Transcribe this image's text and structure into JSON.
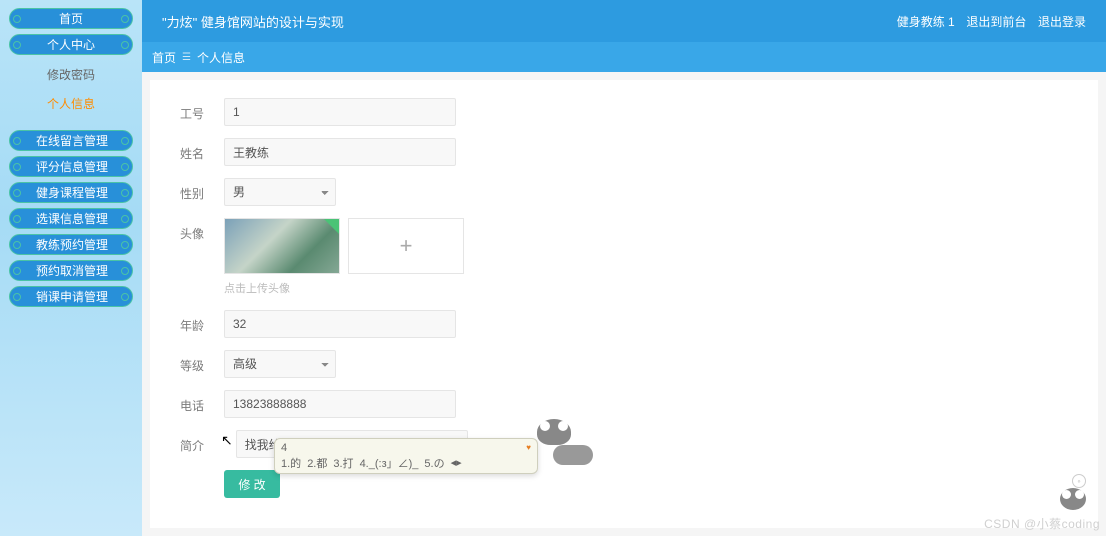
{
  "app_title": "\"力炫\" 健身馆网站的设计与实现",
  "user_role": "健身教练 1",
  "top_actions": {
    "exit_back": "退出到前台",
    "logout": "退出登录"
  },
  "sidebar": {
    "home": "首页",
    "personal_center": "个人中心",
    "sub": {
      "change_pwd": "修改密码",
      "personal_info": "个人信息"
    },
    "items": [
      "在线留言管理",
      "评分信息管理",
      "健身课程管理",
      "选课信息管理",
      "教练预约管理",
      "预约取消管理",
      "销课申请管理"
    ]
  },
  "breadcrumb": {
    "root": "首页",
    "current": "个人信息"
  },
  "form": {
    "id_label": "工号",
    "id_value": "1",
    "name_label": "姓名",
    "name_value": "王教练",
    "gender_label": "性别",
    "gender_value": "男",
    "avatar_label": "头像",
    "avatar_hint": "点击上传头像",
    "age_label": "年龄",
    "age_value": "32",
    "level_label": "等级",
    "level_value": "高级",
    "phone_label": "电话",
    "phone_value": "13823888888",
    "intro_label": "简介",
    "intro_value": "找我给你一个完美d",
    "submit": "修 改"
  },
  "ime": {
    "input": "4",
    "candidates": [
      "1.的",
      "2.都",
      "3.打",
      "4._(:з」∠)_",
      "5.の"
    ],
    "nav": "◂▸"
  },
  "watermark": "CSDN @小蔡coding"
}
